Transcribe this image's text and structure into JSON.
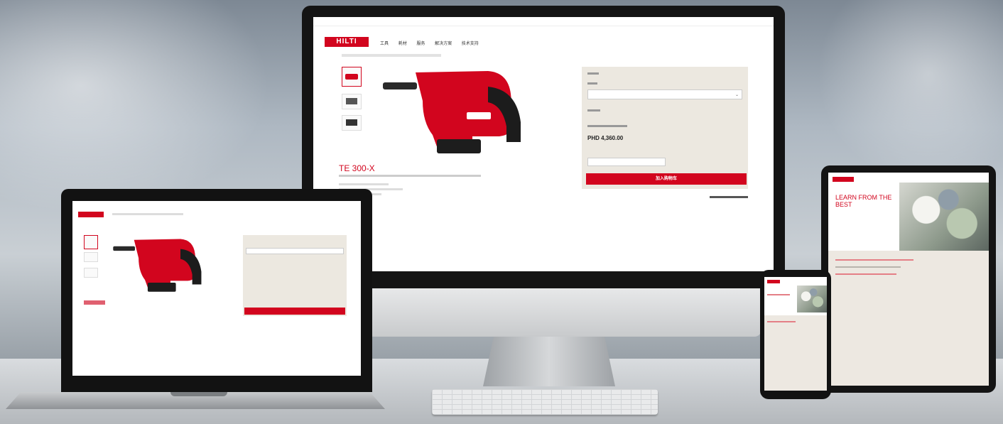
{
  "brand": {
    "name": "HILTI",
    "color": "#d2051e"
  },
  "desktop": {
    "nav": [
      "工具",
      "耗材",
      "服务",
      "解决方案",
      "技术支持"
    ],
    "product_title": "TE 300-X",
    "price": "PHD 4,360.00",
    "cta_label": "加入购物车"
  },
  "tablet": {
    "headline": "LEARN FROM THE BEST"
  },
  "icons": [
    "drill-image",
    "chevron-down-icon"
  ]
}
